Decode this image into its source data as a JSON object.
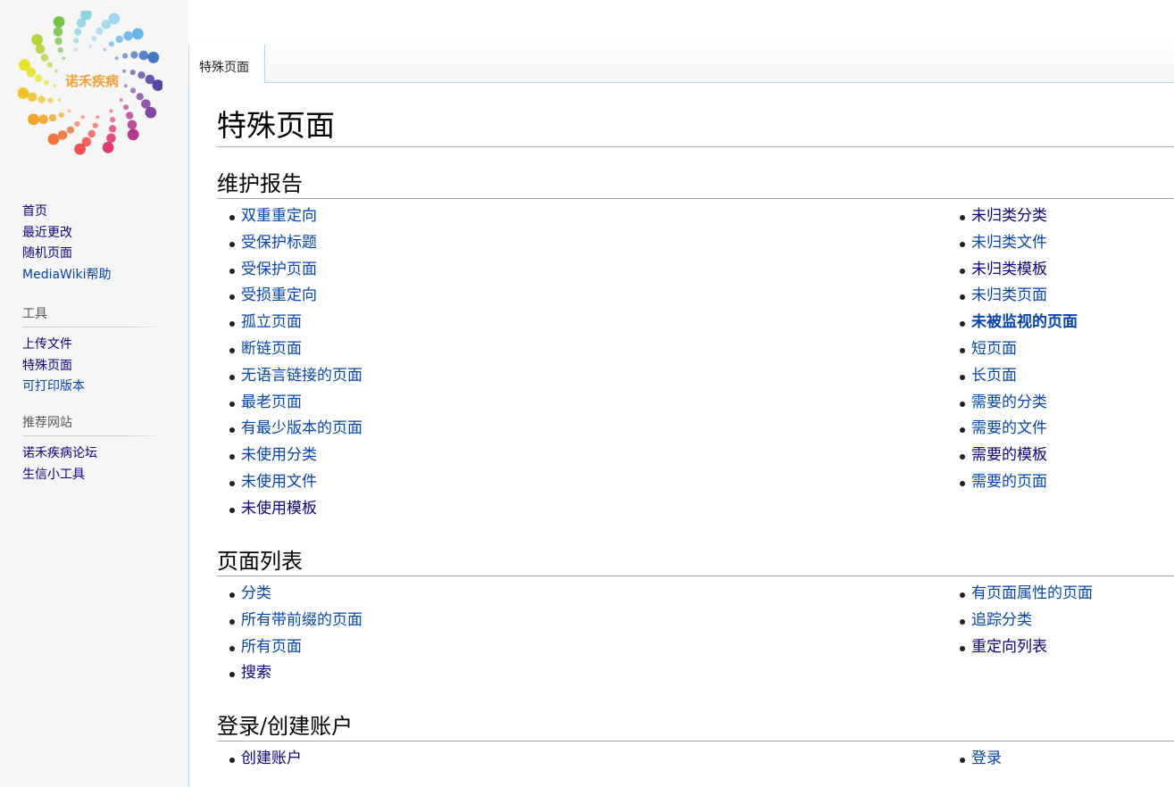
{
  "logo": {
    "text": "诺禾疾病"
  },
  "sidebar": {
    "nav": [
      {
        "label": "首页",
        "visited": true
      },
      {
        "label": "最近更改",
        "visited": true
      },
      {
        "label": "随机页面",
        "visited": true
      },
      {
        "label": "MediaWiki帮助",
        "visited": false
      }
    ],
    "tools": {
      "heading": "工具",
      "items": [
        {
          "label": "上传文件",
          "visited": true
        },
        {
          "label": "特殊页面",
          "visited": true
        },
        {
          "label": "可打印版本",
          "visited": false
        }
      ]
    },
    "recommended": {
      "heading": "推荐网站",
      "items": [
        {
          "label": "诺禾疾病论坛",
          "visited": true
        },
        {
          "label": "生信小工具",
          "visited": true
        }
      ]
    }
  },
  "tabs": {
    "special": "特殊页面"
  },
  "page": {
    "title": "特殊页面"
  },
  "sections": {
    "maintenance": {
      "title": "维护报告",
      "left": [
        {
          "label": "双重重定向",
          "visited": false
        },
        {
          "label": "受保护标题",
          "visited": false
        },
        {
          "label": "受保护页面",
          "visited": false
        },
        {
          "label": "受损重定向",
          "visited": false
        },
        {
          "label": "孤立页面",
          "visited": false
        },
        {
          "label": "断链页面",
          "visited": false
        },
        {
          "label": "无语言链接的页面",
          "visited": false
        },
        {
          "label": "最老页面",
          "visited": false
        },
        {
          "label": "有最少版本的页面",
          "visited": false
        },
        {
          "label": "未使用分类",
          "visited": false
        },
        {
          "label": "未使用文件",
          "visited": false
        },
        {
          "label": "未使用模板",
          "visited": true
        }
      ],
      "right": [
        {
          "label": "未归类分类",
          "visited": true
        },
        {
          "label": "未归类文件",
          "visited": false
        },
        {
          "label": "未归类模板",
          "visited": true
        },
        {
          "label": "未归类页面",
          "visited": false
        },
        {
          "label": "未被监视的页面",
          "visited": false,
          "bold": true
        },
        {
          "label": "短页面",
          "visited": false
        },
        {
          "label": "长页面",
          "visited": false
        },
        {
          "label": "需要的分类",
          "visited": false
        },
        {
          "label": "需要的文件",
          "visited": false
        },
        {
          "label": "需要的模板",
          "visited": true
        },
        {
          "label": "需要的页面",
          "visited": false
        }
      ]
    },
    "page_lists": {
      "title": "页面列表",
      "left": [
        {
          "label": "分类",
          "visited": false
        },
        {
          "label": "所有带前缀的页面",
          "visited": false
        },
        {
          "label": "所有页面",
          "visited": false
        },
        {
          "label": "搜索",
          "visited": true
        }
      ],
      "right": [
        {
          "label": "有页面属性的页面",
          "visited": false
        },
        {
          "label": "追踪分类",
          "visited": false
        },
        {
          "label": "重定向列表",
          "visited": true
        }
      ]
    },
    "login": {
      "title": "登录/创建账户",
      "left": [
        {
          "label": "创建账户",
          "visited": true
        }
      ],
      "right": [
        {
          "label": "登录",
          "visited": false
        }
      ]
    }
  },
  "colors": {
    "link": "#0645ad",
    "visited": "#0b0080",
    "tab_border": "#a7d7f9"
  }
}
